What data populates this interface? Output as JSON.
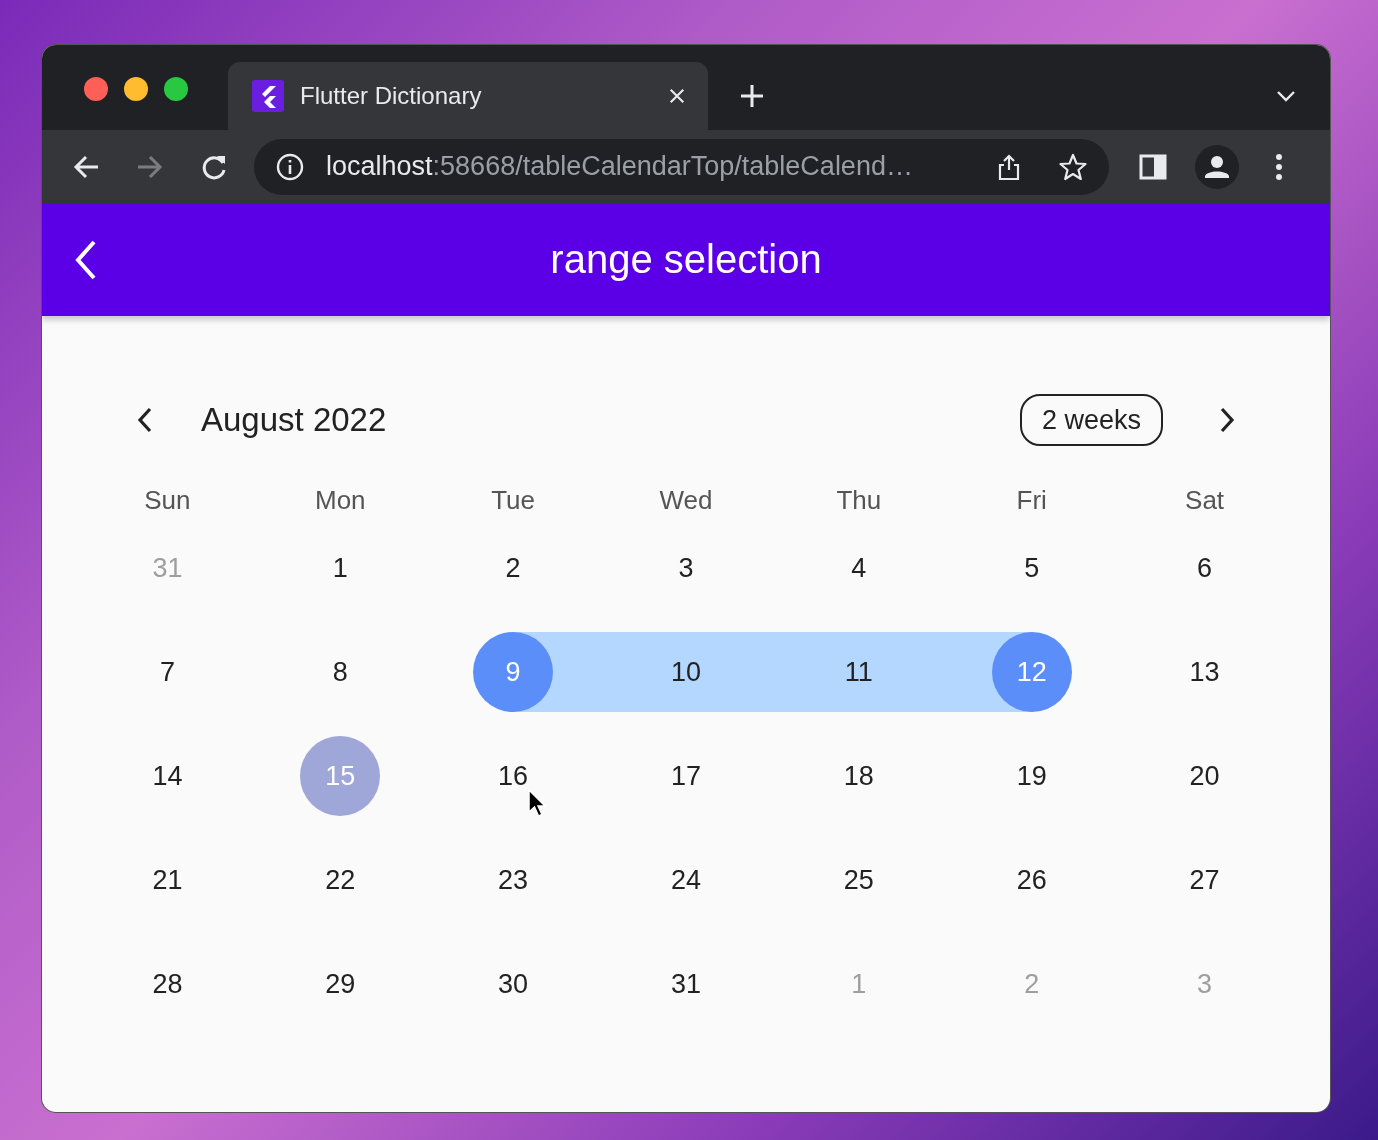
{
  "browser": {
    "tab": {
      "title": "Flutter Dictionary",
      "selected": true
    },
    "nav_buttons": [
      {
        "kind": "back",
        "disabled": false
      },
      {
        "kind": "forward",
        "disabled": true
      },
      {
        "kind": "reload",
        "disabled": false
      }
    ],
    "url_host": "localhost",
    "url_rest": ":58668/tableCalendarTop/tableCalend…"
  },
  "app_bar": {
    "title": "range selection"
  },
  "calendar": {
    "month": "August 2022",
    "format_button": "2 weeks",
    "weekdays": [
      "Sun",
      "Mon",
      "Tue",
      "Wed",
      "Thu",
      "Fri",
      "Sat"
    ],
    "weeks": [
      [
        {
          "day": "31",
          "outside": true,
          "range_start": false,
          "in_range": false,
          "range_end": false,
          "today": false
        },
        {
          "day": "1",
          "outside": false,
          "range_start": false,
          "in_range": false,
          "range_end": false,
          "today": false
        },
        {
          "day": "2",
          "outside": false,
          "range_start": false,
          "in_range": false,
          "range_end": false,
          "today": false
        },
        {
          "day": "3",
          "outside": false,
          "range_start": false,
          "in_range": false,
          "range_end": false,
          "today": false
        },
        {
          "day": "4",
          "outside": false,
          "range_start": false,
          "in_range": false,
          "range_end": false,
          "today": false
        },
        {
          "day": "5",
          "outside": false,
          "range_start": false,
          "in_range": false,
          "range_end": false,
          "today": false
        },
        {
          "day": "6",
          "outside": false,
          "range_start": false,
          "in_range": false,
          "range_end": false,
          "today": false
        }
      ],
      [
        {
          "day": "7",
          "outside": false,
          "range_start": false,
          "in_range": false,
          "range_end": false,
          "today": false
        },
        {
          "day": "8",
          "outside": false,
          "range_start": false,
          "in_range": false,
          "range_end": false,
          "today": false
        },
        {
          "day": "9",
          "outside": false,
          "range_start": true,
          "in_range": false,
          "range_end": false,
          "today": false
        },
        {
          "day": "10",
          "outside": false,
          "range_start": false,
          "in_range": true,
          "range_end": false,
          "today": false
        },
        {
          "day": "11",
          "outside": false,
          "range_start": false,
          "in_range": true,
          "range_end": false,
          "today": false
        },
        {
          "day": "12",
          "outside": false,
          "range_start": false,
          "in_range": false,
          "range_end": true,
          "today": false
        },
        {
          "day": "13",
          "outside": false,
          "range_start": false,
          "in_range": false,
          "range_end": false,
          "today": false
        }
      ],
      [
        {
          "day": "14",
          "outside": false,
          "range_start": false,
          "in_range": false,
          "range_end": false,
          "today": false
        },
        {
          "day": "15",
          "outside": false,
          "range_start": false,
          "in_range": false,
          "range_end": false,
          "today": true
        },
        {
          "day": "16",
          "outside": false,
          "range_start": false,
          "in_range": false,
          "range_end": false,
          "today": false
        },
        {
          "day": "17",
          "outside": false,
          "range_start": false,
          "in_range": false,
          "range_end": false,
          "today": false
        },
        {
          "day": "18",
          "outside": false,
          "range_start": false,
          "in_range": false,
          "range_end": false,
          "today": false
        },
        {
          "day": "19",
          "outside": false,
          "range_start": false,
          "in_range": false,
          "range_end": false,
          "today": false
        },
        {
          "day": "20",
          "outside": false,
          "range_start": false,
          "in_range": false,
          "range_end": false,
          "today": false
        }
      ],
      [
        {
          "day": "21",
          "outside": false,
          "range_start": false,
          "in_range": false,
          "range_end": false,
          "today": false
        },
        {
          "day": "22",
          "outside": false,
          "range_start": false,
          "in_range": false,
          "range_end": false,
          "today": false
        },
        {
          "day": "23",
          "outside": false,
          "range_start": false,
          "in_range": false,
          "range_end": false,
          "today": false
        },
        {
          "day": "24",
          "outside": false,
          "range_start": false,
          "in_range": false,
          "range_end": false,
          "today": false
        },
        {
          "day": "25",
          "outside": false,
          "range_start": false,
          "in_range": false,
          "range_end": false,
          "today": false
        },
        {
          "day": "26",
          "outside": false,
          "range_start": false,
          "in_range": false,
          "range_end": false,
          "today": false
        },
        {
          "day": "27",
          "outside": false,
          "range_start": false,
          "in_range": false,
          "range_end": false,
          "today": false
        }
      ],
      [
        {
          "day": "28",
          "outside": false,
          "range_start": false,
          "in_range": false,
          "range_end": false,
          "today": false
        },
        {
          "day": "29",
          "outside": false,
          "range_start": false,
          "in_range": false,
          "range_end": false,
          "today": false
        },
        {
          "day": "30",
          "outside": false,
          "range_start": false,
          "in_range": false,
          "range_end": false,
          "today": false
        },
        {
          "day": "31",
          "outside": false,
          "range_start": false,
          "in_range": false,
          "range_end": false,
          "today": false
        },
        {
          "day": "1",
          "outside": true,
          "range_start": false,
          "in_range": false,
          "range_end": false,
          "today": false
        },
        {
          "day": "2",
          "outside": true,
          "range_start": false,
          "in_range": false,
          "range_end": false,
          "today": false
        },
        {
          "day": "3",
          "outside": true,
          "range_start": false,
          "in_range": false,
          "range_end": false,
          "today": false
        }
      ]
    ]
  }
}
